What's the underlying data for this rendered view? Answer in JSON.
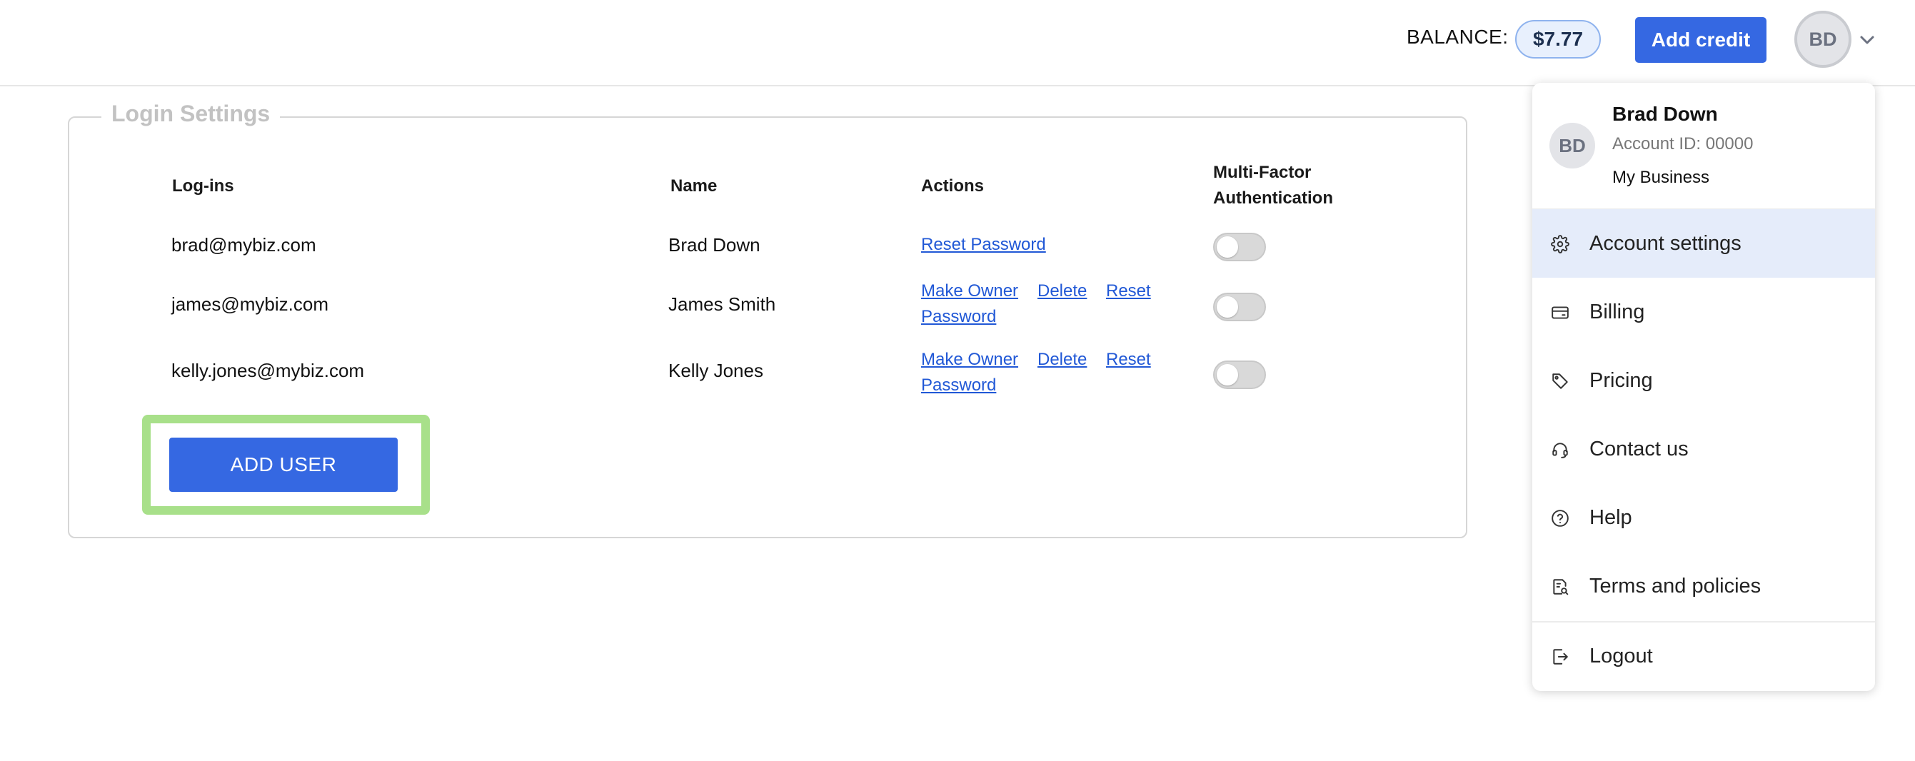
{
  "header": {
    "balance_label": "BALANCE:",
    "balance_value": "$7.77",
    "add_credit_label": "Add credit",
    "avatar_initials": "BD"
  },
  "login_settings": {
    "legend": "Login Settings",
    "columns": {
      "logins": "Log-ins",
      "name": "Name",
      "actions": "Actions",
      "mfa_line1": "Multi-Factor",
      "mfa_line2": "Authentication"
    },
    "rows": [
      {
        "login": "brad@mybiz.com",
        "name": "Brad Down",
        "reset_password": "Reset Password",
        "mfa_enabled": false
      },
      {
        "login": "james@mybiz.com",
        "name": "James Smith",
        "make_owner": "Make Owner",
        "delete": "Delete",
        "reset_line1": "Reset",
        "reset_line2": "Password",
        "mfa_enabled": false
      },
      {
        "login": "kelly.jones@mybiz.com",
        "name": "Kelly Jones",
        "make_owner": "Make Owner",
        "delete": "Delete",
        "reset_line1": "Reset",
        "reset_line2": "Password",
        "mfa_enabled": false
      }
    ],
    "add_user_label": "ADD USER"
  },
  "account_menu": {
    "avatar_initials": "BD",
    "user_name": "Brad Down",
    "account_id": "Account ID: 00000",
    "business_name": "My Business",
    "items": [
      {
        "label": "Account settings",
        "icon": "gear-icon",
        "active": true
      },
      {
        "label": "Billing",
        "icon": "card-icon"
      },
      {
        "label": "Pricing",
        "icon": "tag-icon"
      },
      {
        "label": "Contact us",
        "icon": "headset-icon"
      },
      {
        "label": "Help",
        "icon": "help-circle-icon"
      },
      {
        "label": "Terms and policies",
        "icon": "document-search-icon"
      },
      {
        "label": "Logout",
        "icon": "logout-icon"
      }
    ]
  },
  "colors": {
    "primary": "#3568e2",
    "link": "#2158d6",
    "highlight": "#a8e08a",
    "menu_active_bg": "#e5ecfa"
  }
}
